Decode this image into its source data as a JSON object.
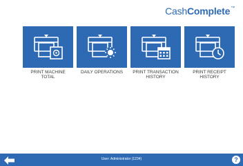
{
  "brand": {
    "light": "Cash",
    "bold": "Complete",
    "mark": "™"
  },
  "tiles": [
    {
      "label": "PRINT MACHINE\nTOTAL",
      "icon": "printer-safe-icon"
    },
    {
      "label": "DAILY OPERATIONS",
      "icon": "printer-sun-icon"
    },
    {
      "label": "PRINT TRANSACTION\nHISTORY",
      "icon": "printer-calendar-icon"
    },
    {
      "label": "PRINT RECEIPT\nHISTORY",
      "icon": "printer-clock-icon"
    }
  ],
  "footer": {
    "status": "User: Administrator (1234)",
    "help": "?",
    "back_icon": "arrow-left-icon"
  },
  "colors": {
    "primary": "#2e6ab3",
    "tile_bg": "#2e6ab3",
    "text": "#3a3a3a"
  }
}
